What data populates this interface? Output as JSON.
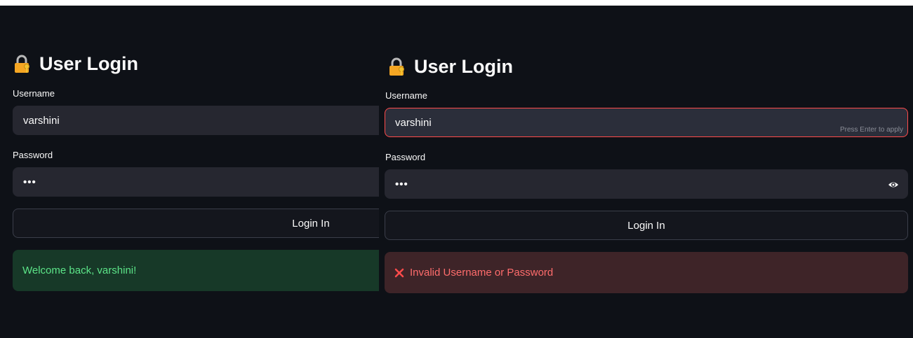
{
  "left": {
    "title": "User Login",
    "username_label": "Username",
    "username_value": "varshini",
    "password_label": "Password",
    "password_value": "•••",
    "login_button": "Login In",
    "success_message": "Welcome back, varshini!"
  },
  "right": {
    "title": "User Login",
    "username_label": "Username",
    "username_value": "varshini",
    "username_hint": "Press Enter to apply",
    "password_label": "Password",
    "password_value": "•••",
    "login_button": "Login In",
    "error_message": "Invalid Username or Password"
  },
  "icons": {
    "title": "lock-key-icon",
    "show_password": "eye-icon",
    "error": "x-icon"
  },
  "colors": {
    "background": "#0e1117",
    "input_bg": "#262730",
    "focus_border": "#ff4b4b",
    "success_bg": "#173928",
    "success_text": "#5ce488",
    "error_bg": "#3e2428",
    "error_text": "#ff6c6c"
  }
}
